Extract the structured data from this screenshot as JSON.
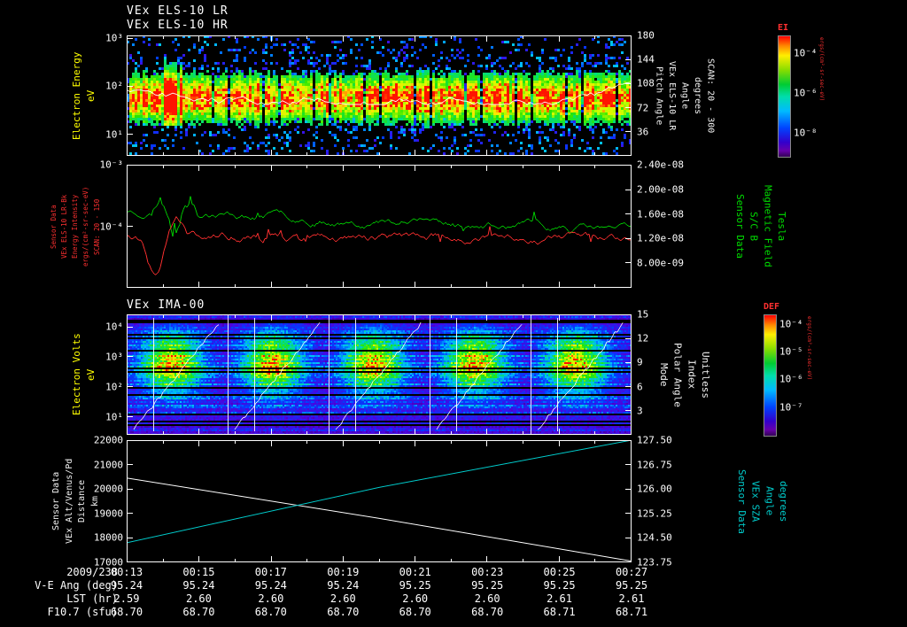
{
  "titles": {
    "els_lr": "VEx ELS-10 LR",
    "els_hr": "VEx ELS-10 HR",
    "ima": "VEx IMA-00"
  },
  "left_labels": {
    "els": {
      "lines": [
        "Electron Energy",
        "eV"
      ],
      "color": "#ffff00"
    },
    "intensity": {
      "lines": [
        "Sensor Data",
        "VEx ELS-10 LR-Bk",
        "Energy Intensity",
        "ergs/(cm²-sr-sec-eV)",
        "SCAN: 20 - 150"
      ],
      "color": "#ff3030"
    },
    "ima": {
      "lines": [
        "Electron Volts",
        "eV"
      ],
      "color": "#ffff00"
    },
    "alt": {
      "lines": [
        "Sensor Data",
        "VEx Alt/Venus/Pd",
        "Distance",
        "km"
      ],
      "color": "#f2f2f2"
    }
  },
  "right_labels": {
    "els": {
      "lines": [
        "Pitch Angle",
        "VEx ELS-10 LR",
        "Angle",
        "degrees",
        "SCAN: 20 - 300"
      ],
      "color": "#ffffff"
    },
    "mag": {
      "lines": [
        "Sensor Data",
        "S/C B",
        "Magnetic Field",
        "Tesla"
      ],
      "color": "#00dd00"
    },
    "ima": {
      "lines": [
        "Mode",
        "Polar Angle",
        "Index",
        "Unitless"
      ],
      "color": "#ffffff"
    },
    "sza": {
      "lines": [
        "Sensor Data",
        "VEx SZA",
        "Angle",
        "degrees"
      ],
      "color": "#00cccc"
    }
  },
  "colorbars": [
    {
      "label": "EI",
      "units": "ergs/(cm²-sr-sec-eV)",
      "ticks": [
        {
          "label": "10⁻⁴",
          "f": 0.15
        },
        {
          "label": "10⁻⁶",
          "f": 0.48
        },
        {
          "label": "10⁻⁸",
          "f": 0.81
        }
      ]
    },
    {
      "label": "DEF",
      "units": "ergs/(cm²-sr-sec-eV)",
      "ticks": [
        {
          "label": "10⁻⁴",
          "f": 0.08
        },
        {
          "label": "10⁻⁵",
          "f": 0.31
        },
        {
          "label": "10⁻⁶",
          "f": 0.54
        },
        {
          "label": "10⁻⁷",
          "f": 0.77
        }
      ]
    }
  ],
  "axes": {
    "p1_left": [
      {
        "label": "10³",
        "f": 0.02
      },
      {
        "label": "10²",
        "f": 0.42
      },
      {
        "label": "10¹",
        "f": 0.82
      }
    ],
    "p1_right": [
      {
        "label": "180",
        "f": 0.0
      },
      {
        "label": "144",
        "f": 0.2
      },
      {
        "label": "108",
        "f": 0.4
      },
      {
        "label": "72",
        "f": 0.6
      },
      {
        "label": "36",
        "f": 0.8
      }
    ],
    "p2_left": [
      {
        "label": "10⁻³",
        "f": 0.0
      },
      {
        "label": "10⁻⁴",
        "f": 0.5
      }
    ],
    "p2_right": [
      {
        "label": "2.40e-08",
        "f": 0.0
      },
      {
        "label": "2.00e-08",
        "f": 0.2
      },
      {
        "label": "1.60e-08",
        "f": 0.4
      },
      {
        "label": "1.20e-08",
        "f": 0.6
      },
      {
        "label": "8.00e-09",
        "f": 0.8
      }
    ],
    "p3_left": [
      {
        "label": "10⁴",
        "f": 0.1
      },
      {
        "label": "10³",
        "f": 0.35
      },
      {
        "label": "10²",
        "f": 0.6
      },
      {
        "label": "10¹",
        "f": 0.85
      }
    ],
    "p3_right": [
      {
        "label": "15",
        "f": 0.0
      },
      {
        "label": "12",
        "f": 0.2
      },
      {
        "label": "9",
        "f": 0.4
      },
      {
        "label": "6",
        "f": 0.6
      },
      {
        "label": "3",
        "f": 0.8
      }
    ],
    "p4_left": [
      {
        "label": "22000",
        "f": 0.0
      },
      {
        "label": "21000",
        "f": 0.2
      },
      {
        "label": "20000",
        "f": 0.4
      },
      {
        "label": "19000",
        "f": 0.6
      },
      {
        "label": "18000",
        "f": 0.8
      },
      {
        "label": "17000",
        "f": 1.0
      }
    ],
    "p4_right": [
      {
        "label": "127.50",
        "f": 0.0
      },
      {
        "label": "126.75",
        "f": 0.2
      },
      {
        "label": "126.00",
        "f": 0.4
      },
      {
        "label": "125.25",
        "f": 0.6
      },
      {
        "label": "124.50",
        "f": 0.8
      },
      {
        "label": "123.75",
        "f": 1.0
      }
    ]
  },
  "time_axis": {
    "date": "2009/238",
    "ticks": [
      "00:13",
      "00:15",
      "00:17",
      "00:19",
      "00:21",
      "00:23",
      "00:25",
      "00:27"
    ]
  },
  "bottom_rows": [
    {
      "label": "V-E Ang (deg)",
      "values": [
        "95.24",
        "95.24",
        "95.24",
        "95.24",
        "95.25",
        "95.25",
        "95.25",
        "95.25"
      ]
    },
    {
      "label": "LST (hr)",
      "values": [
        "2.59",
        "2.60",
        "2.60",
        "2.60",
        "2.60",
        "2.60",
        "2.61",
        "2.61"
      ]
    },
    {
      "label": "F10.7 (sfu)",
      "values": [
        "68.70",
        "68.70",
        "68.70",
        "68.70",
        "68.70",
        "68.70",
        "68.71",
        "68.71"
      ]
    }
  ],
  "chart_data": [
    {
      "id": "els-spectrogram",
      "type": "heatmap",
      "title": "VEx ELS-10 LR / VEx ELS-10 HR electron energy-time spectrogram",
      "x": {
        "label": "UT 2009/238",
        "start": "00:13",
        "end": "00:27",
        "tick_interval_min": 2
      },
      "y": {
        "label": "Electron Energy (eV)",
        "scale": "log",
        "ticks": [
          10,
          100,
          1000
        ]
      },
      "y2": {
        "label": "Pitch Angle (degrees) VEx ELS-10 LR Angle SCAN: 20 - 300",
        "min": 0,
        "max": 180,
        "ticks": [
          180,
          144,
          108,
          72,
          36
        ]
      },
      "color": {
        "label": "EI",
        "units": "ergs/(cm²-sr-sec-eV)",
        "scale": "log",
        "ticks": [
          0.0001,
          1e-06,
          1e-08
        ]
      },
      "features": "continuous intense flux band ~20-200 eV (red/yellow core, green edges) across whole interval; sparse cyan/blue speckle elsewhere; vertical sweep striping; white trace line through band; bright patch near 00:14",
      "render": {
        "seed": 11,
        "band_log10_center": 1.78,
        "band_log10_sigma": 0.34,
        "log_top": 3.06,
        "log_span": 2.5,
        "blob_x": [
          38,
          62
        ]
      }
    },
    {
      "id": "intensity-bfield",
      "type": "line",
      "y_left": {
        "label": "VEx ELS Energy Intensity ergs/(cm²-sr-sec-eV)",
        "scale": "log",
        "min": 1e-05,
        "max": 0.001,
        "ticks": [
          0.001,
          0.0001
        ]
      },
      "y_right": {
        "label": "S/C B Magnetic Field (Tesla)",
        "min": 4e-09,
        "max": 2.4e-08,
        "ticks": [
          2.4e-08,
          2e-08,
          1.6e-08,
          1.2e-08,
          8e-09
        ]
      },
      "series": [
        {
          "name": "S/C B Magnetic Field",
          "color": "#00cc00",
          "axis": "right",
          "approx": "starts ~1.65e-8 T, sharp spikes to ~2.1e-8 near 00:14, noisy slow decline to ~1.35e-8 by 00:27"
        },
        {
          "name": "VEx ELS-10 LR-Bk Energy Intensity",
          "color": "#ff3030",
          "axis": "left",
          "approx": "noisy ~7e-5 level, deep dip to ~1.3e-5 near 00:14, brief rise ~1.4e-4 after, ±0.15 decade jitter"
        }
      ],
      "render": {
        "seed": 23
      }
    },
    {
      "id": "ima-spectrogram",
      "type": "heatmap",
      "title": "VEx IMA-00 energy-time spectrogram",
      "y": {
        "label": "Electron Volts (eV)",
        "scale": "log",
        "ticks": [
          10,
          100,
          1000,
          10000
        ]
      },
      "y2": {
        "label": "Mode Polar Angle Index (Unitless)",
        "min": 0,
        "max": 15,
        "ticks": [
          15,
          12,
          9,
          6,
          3
        ]
      },
      "color": {
        "label": "DEF",
        "units": "ergs/(cm²-sr-sec-eV)",
        "scale": "log",
        "ticks": [
          0.0001,
          1e-05,
          1e-06,
          1e-07
        ]
      },
      "features": "five repeating ~3-minute sweep cells; blue noisy background with horizontal banding, bright yellow-green blob near 10²-10³ eV in each cell, white diagonal sweep staircase and white vertical cell-boundary lines",
      "render": {
        "seed": 37,
        "cells": 5,
        "log_top": 4.4,
        "log_span": 4.0,
        "blob_log10_center": 2.8
      }
    },
    {
      "id": "alt-sza",
      "type": "line",
      "y_left": {
        "label": "VEx Alt/Venus/Pd Distance (km)",
        "min": 17000,
        "max": 22000,
        "ticks": [
          22000,
          21000,
          20000,
          19000,
          18000,
          17000
        ]
      },
      "y_right": {
        "label": "VEx SZA Angle (degrees)",
        "min": 123.75,
        "max": 127.5,
        "ticks": [
          127.5,
          126.75,
          126.0,
          125.25,
          124.5,
          123.75
        ]
      },
      "series": [
        {
          "name": "VEx Alt/Venus/Pd Distance",
          "color": "#ffffff",
          "axis": "left",
          "points_x_frac": [
            0,
            0.5,
            1
          ],
          "values": [
            20450,
            18800,
            17050
          ]
        },
        {
          "name": "VEx SZA Angle",
          "color": "#00cccc",
          "axis": "right",
          "points_x_frac": [
            0,
            0.5,
            1
          ],
          "values": [
            124.35,
            126.05,
            127.5
          ]
        }
      ]
    }
  ]
}
